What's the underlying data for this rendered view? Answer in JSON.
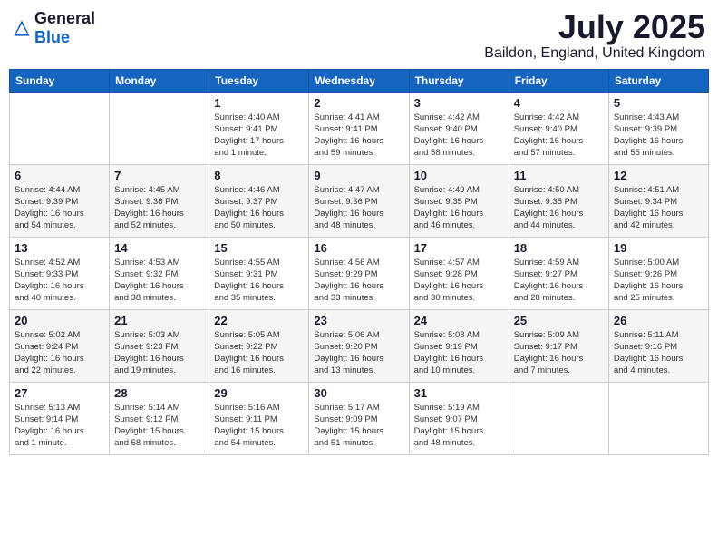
{
  "logo": {
    "general": "General",
    "blue": "Blue"
  },
  "title": "July 2025",
  "location": "Baildon, England, United Kingdom",
  "days_of_week": [
    "Sunday",
    "Monday",
    "Tuesday",
    "Wednesday",
    "Thursday",
    "Friday",
    "Saturday"
  ],
  "weeks": [
    [
      {
        "day": "",
        "info": ""
      },
      {
        "day": "",
        "info": ""
      },
      {
        "day": "1",
        "info": "Sunrise: 4:40 AM\nSunset: 9:41 PM\nDaylight: 17 hours\nand 1 minute."
      },
      {
        "day": "2",
        "info": "Sunrise: 4:41 AM\nSunset: 9:41 PM\nDaylight: 16 hours\nand 59 minutes."
      },
      {
        "day": "3",
        "info": "Sunrise: 4:42 AM\nSunset: 9:40 PM\nDaylight: 16 hours\nand 58 minutes."
      },
      {
        "day": "4",
        "info": "Sunrise: 4:42 AM\nSunset: 9:40 PM\nDaylight: 16 hours\nand 57 minutes."
      },
      {
        "day": "5",
        "info": "Sunrise: 4:43 AM\nSunset: 9:39 PM\nDaylight: 16 hours\nand 55 minutes."
      }
    ],
    [
      {
        "day": "6",
        "info": "Sunrise: 4:44 AM\nSunset: 9:39 PM\nDaylight: 16 hours\nand 54 minutes."
      },
      {
        "day": "7",
        "info": "Sunrise: 4:45 AM\nSunset: 9:38 PM\nDaylight: 16 hours\nand 52 minutes."
      },
      {
        "day": "8",
        "info": "Sunrise: 4:46 AM\nSunset: 9:37 PM\nDaylight: 16 hours\nand 50 minutes."
      },
      {
        "day": "9",
        "info": "Sunrise: 4:47 AM\nSunset: 9:36 PM\nDaylight: 16 hours\nand 48 minutes."
      },
      {
        "day": "10",
        "info": "Sunrise: 4:49 AM\nSunset: 9:35 PM\nDaylight: 16 hours\nand 46 minutes."
      },
      {
        "day": "11",
        "info": "Sunrise: 4:50 AM\nSunset: 9:35 PM\nDaylight: 16 hours\nand 44 minutes."
      },
      {
        "day": "12",
        "info": "Sunrise: 4:51 AM\nSunset: 9:34 PM\nDaylight: 16 hours\nand 42 minutes."
      }
    ],
    [
      {
        "day": "13",
        "info": "Sunrise: 4:52 AM\nSunset: 9:33 PM\nDaylight: 16 hours\nand 40 minutes."
      },
      {
        "day": "14",
        "info": "Sunrise: 4:53 AM\nSunset: 9:32 PM\nDaylight: 16 hours\nand 38 minutes."
      },
      {
        "day": "15",
        "info": "Sunrise: 4:55 AM\nSunset: 9:31 PM\nDaylight: 16 hours\nand 35 minutes."
      },
      {
        "day": "16",
        "info": "Sunrise: 4:56 AM\nSunset: 9:29 PM\nDaylight: 16 hours\nand 33 minutes."
      },
      {
        "day": "17",
        "info": "Sunrise: 4:57 AM\nSunset: 9:28 PM\nDaylight: 16 hours\nand 30 minutes."
      },
      {
        "day": "18",
        "info": "Sunrise: 4:59 AM\nSunset: 9:27 PM\nDaylight: 16 hours\nand 28 minutes."
      },
      {
        "day": "19",
        "info": "Sunrise: 5:00 AM\nSunset: 9:26 PM\nDaylight: 16 hours\nand 25 minutes."
      }
    ],
    [
      {
        "day": "20",
        "info": "Sunrise: 5:02 AM\nSunset: 9:24 PM\nDaylight: 16 hours\nand 22 minutes."
      },
      {
        "day": "21",
        "info": "Sunrise: 5:03 AM\nSunset: 9:23 PM\nDaylight: 16 hours\nand 19 minutes."
      },
      {
        "day": "22",
        "info": "Sunrise: 5:05 AM\nSunset: 9:22 PM\nDaylight: 16 hours\nand 16 minutes."
      },
      {
        "day": "23",
        "info": "Sunrise: 5:06 AM\nSunset: 9:20 PM\nDaylight: 16 hours\nand 13 minutes."
      },
      {
        "day": "24",
        "info": "Sunrise: 5:08 AM\nSunset: 9:19 PM\nDaylight: 16 hours\nand 10 minutes."
      },
      {
        "day": "25",
        "info": "Sunrise: 5:09 AM\nSunset: 9:17 PM\nDaylight: 16 hours\nand 7 minutes."
      },
      {
        "day": "26",
        "info": "Sunrise: 5:11 AM\nSunset: 9:16 PM\nDaylight: 16 hours\nand 4 minutes."
      }
    ],
    [
      {
        "day": "27",
        "info": "Sunrise: 5:13 AM\nSunset: 9:14 PM\nDaylight: 16 hours\nand 1 minute."
      },
      {
        "day": "28",
        "info": "Sunrise: 5:14 AM\nSunset: 9:12 PM\nDaylight: 15 hours\nand 58 minutes."
      },
      {
        "day": "29",
        "info": "Sunrise: 5:16 AM\nSunset: 9:11 PM\nDaylight: 15 hours\nand 54 minutes."
      },
      {
        "day": "30",
        "info": "Sunrise: 5:17 AM\nSunset: 9:09 PM\nDaylight: 15 hours\nand 51 minutes."
      },
      {
        "day": "31",
        "info": "Sunrise: 5:19 AM\nSunset: 9:07 PM\nDaylight: 15 hours\nand 48 minutes."
      },
      {
        "day": "",
        "info": ""
      },
      {
        "day": "",
        "info": ""
      }
    ]
  ]
}
